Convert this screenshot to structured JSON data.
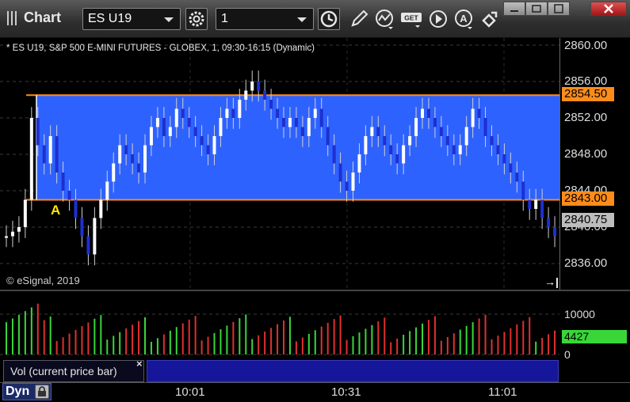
{
  "toolbar": {
    "title": "Chart",
    "symbol": "ES U19",
    "interval": "1"
  },
  "chart": {
    "legend": "* ES U19, S&P 500 E-MINI FUTURES - GLOBEX, 1, 09:30-16:15 (Dynamic)",
    "copyright": "© eSignal, 2019",
    "marker": "A",
    "price_ticks": [
      "2860.00",
      "2856.00",
      "2852.00",
      "2848.00",
      "2844.00",
      "2840.00",
      "2836.00"
    ],
    "upper_level": "2854.50",
    "lower_level": "2843.00",
    "last_price": "2840.75",
    "colors": {
      "band": "#2e62ff",
      "level_line": "#ff8c1a",
      "up_bar": "#ffffff",
      "down_bar": "#1f2fd0",
      "vol_up": "#39d639",
      "vol_down": "#e03030"
    }
  },
  "volume": {
    "label": "Vol (current price bar)",
    "close": "×",
    "ticks": [
      "10000",
      "0"
    ],
    "current": "4427"
  },
  "time_axis": {
    "labels": [
      "10:01",
      "10:31",
      "11:01"
    ],
    "mode": "Dyn"
  }
}
